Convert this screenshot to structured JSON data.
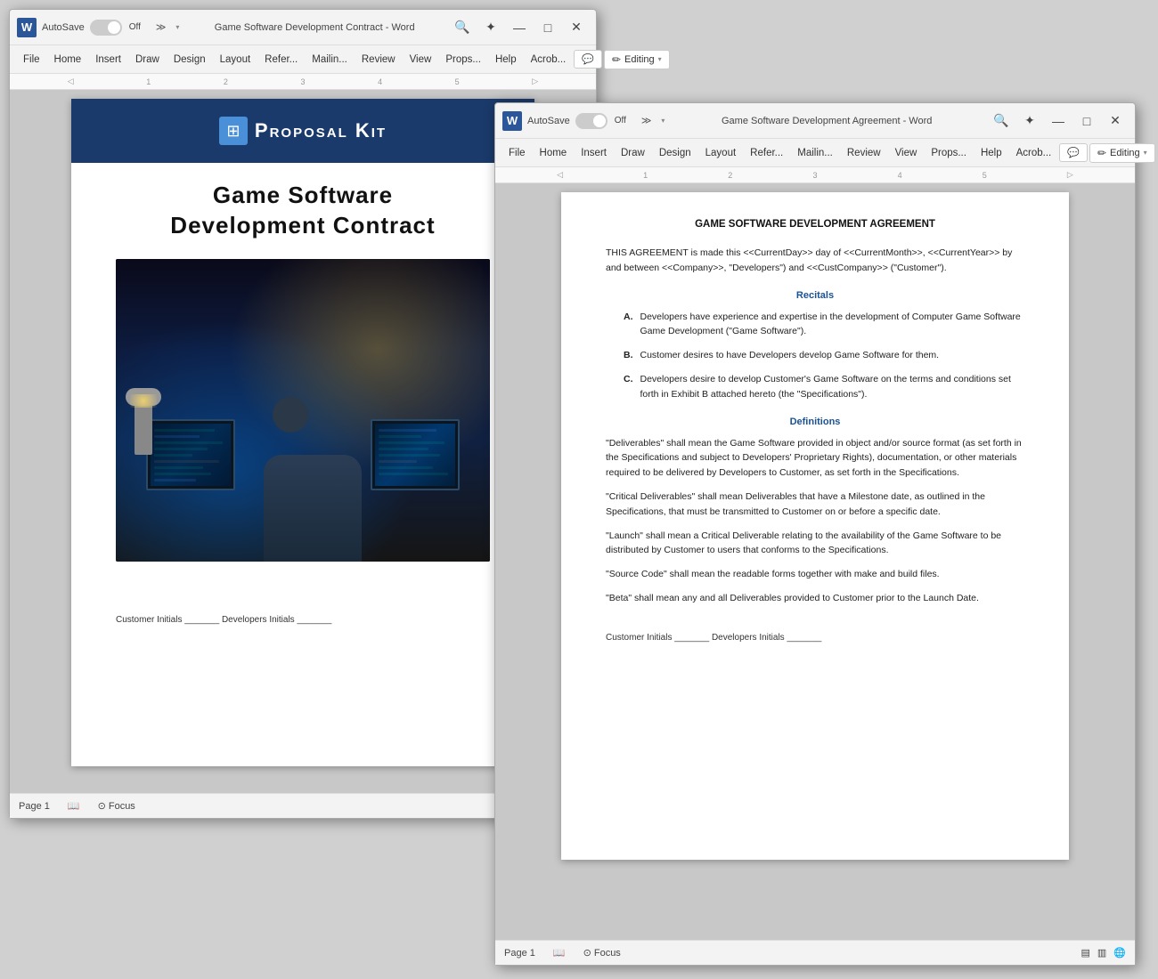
{
  "window1": {
    "title": "Game Software Development Contract - Word",
    "autosave": "AutoSave",
    "toggle_state": "Off",
    "menu_items": [
      "File",
      "Home",
      "Insert",
      "Draw",
      "Design",
      "Layout",
      "References",
      "Mailings",
      "Review",
      "View",
      "Props",
      "Help",
      "Acrobat"
    ],
    "editing_label": "Editing",
    "comment_icon": "💬",
    "pencil_icon": "✏",
    "page_label": "Page 1",
    "cover": {
      "logo_text": "Proposal Kit",
      "logo_symbol": "⊞",
      "title_line1": "Game Software",
      "title_line2": "Development Contract",
      "initials": "Customer Initials _______ Developers Initials _______"
    }
  },
  "window2": {
    "title": "Game Software Development Agreement - Word",
    "autosave": "AutoSave",
    "toggle_state": "Off",
    "menu_items": [
      "File",
      "Home",
      "Insert",
      "Draw",
      "Design",
      "Layout",
      "References",
      "Mailings",
      "Review",
      "View",
      "Props",
      "Help",
      "Acrobat"
    ],
    "editing_label": "Editing",
    "comment_icon": "💬",
    "pencil_icon": "✏",
    "page_label": "Page 1",
    "content": {
      "doc_title": "GAME SOFTWARE DEVELOPMENT AGREEMENT",
      "intro": "THIS AGREEMENT is made this <<CurrentDay>> day of <<CurrentMonth>>, <<CurrentYear>> by and between <<Company>>, \"Developers\") and <<CustCompany>> (\"Customer\").",
      "recitals_heading": "Recitals",
      "recitals": [
        {
          "letter": "A.",
          "text": "Developers have experience and expertise in the development of Computer Game Software Game Development (\"Game Software\")."
        },
        {
          "letter": "B.",
          "text": "Customer desires to have Developers develop Game Software for them."
        },
        {
          "letter": "C.",
          "text": "Developers desire to develop Customer's Game Software on the terms and conditions set forth in Exhibit B attached hereto (the \"Specifications\")."
        }
      ],
      "definitions_heading": "Definitions",
      "definitions": [
        "\"Deliverables\" shall mean the Game Software provided in object and/or source format (as set forth in the Specifications and subject to Developers' Proprietary Rights), documentation, or other materials required to be delivered by Developers to Customer, as set forth in the Specifications.",
        "\"Critical Deliverables\" shall mean Deliverables that have a Milestone date, as outlined in the Specifications, that must be transmitted to Customer on or before a specific date.",
        "\"Launch\" shall mean a Critical Deliverable relating to the availability of the Game Software to be distributed by Customer to users that conforms to the Specifications.",
        "\"Source Code\" shall mean the readable forms together with make and build files.",
        "\"Beta\" shall mean any and all Deliverables provided to Customer prior to the Launch Date."
      ],
      "initials": "Customer Initials _______ Developers Initials _______"
    }
  },
  "icons": {
    "minimize": "—",
    "maximize": "□",
    "close": "✕",
    "search": "🔍",
    "ribbon_star": "✦",
    "focus": "⊙",
    "read": "📖",
    "web": "🌐"
  }
}
